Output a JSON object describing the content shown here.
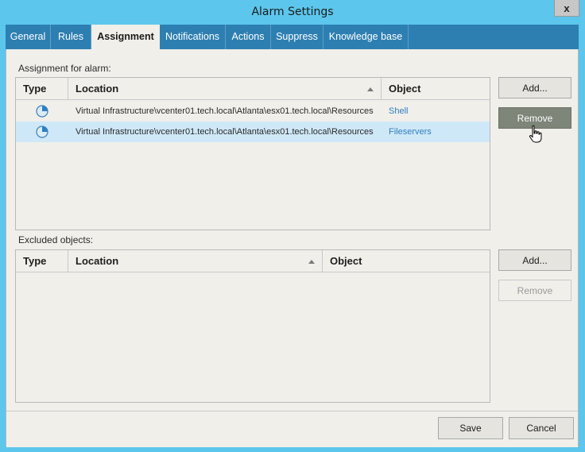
{
  "window": {
    "title": "Alarm Settings",
    "close_glyph": "x"
  },
  "tabs": [
    {
      "label": "General"
    },
    {
      "label": "Rules"
    },
    {
      "label": "Assignment"
    },
    {
      "label": "Notifications"
    },
    {
      "label": "Actions"
    },
    {
      "label": "Suppress"
    },
    {
      "label": "Knowledge base"
    }
  ],
  "assignment": {
    "section_label": "Assignment for alarm:",
    "columns": {
      "type": "Type",
      "location": "Location",
      "object": "Object"
    },
    "rows": [
      {
        "type_icon": "resource-pool-icon",
        "location": "Virtual Infrastructure\\vcenter01.tech.local\\Atlanta\\esx01.tech.local\\Resources",
        "object": "Shell"
      },
      {
        "type_icon": "resource-pool-icon",
        "location": "Virtual Infrastructure\\vcenter01.tech.local\\Atlanta\\esx01.tech.local\\Resources",
        "object": "Fileservers"
      }
    ],
    "add_label": "Add...",
    "remove_label": "Remove"
  },
  "excluded": {
    "section_label": "Excluded objects:",
    "columns": {
      "type": "Type",
      "location": "Location",
      "object": "Object"
    },
    "add_label": "Add...",
    "remove_label": "Remove"
  },
  "footer": {
    "save_label": "Save",
    "cancel_label": "Cancel"
  },
  "colors": {
    "titlebar": "#5cc6ec",
    "tabbar": "#2d7fb2",
    "selected_row": "#cfe8f8",
    "link": "#2f7ec2",
    "hover_button": "#7e8579"
  }
}
